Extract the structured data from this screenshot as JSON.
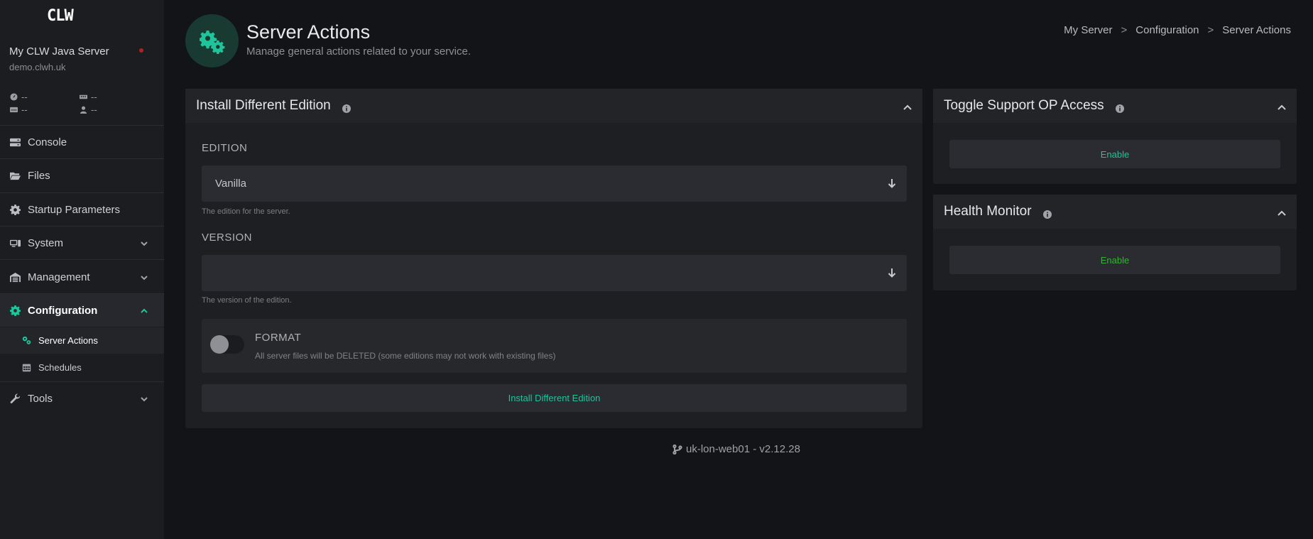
{
  "sidebar": {
    "logo": "CLW",
    "server_name": "My CLW Java Server",
    "server_host": "demo.clwh.uk",
    "stats": {
      "cpu": "--",
      "memory": "--",
      "disk": "--",
      "players": "--"
    },
    "nav": {
      "console": "Console",
      "files": "Files",
      "startup": "Startup Parameters",
      "system": "System",
      "management": "Management",
      "configuration": "Configuration",
      "server_actions": "Server Actions",
      "schedules": "Schedules",
      "tools": "Tools"
    }
  },
  "header": {
    "title": "Server Actions",
    "subtitle": "Manage general actions related to your service.",
    "breadcrumb": [
      "My Server",
      ">",
      "Configuration",
      ">",
      "Server Actions"
    ]
  },
  "install_card": {
    "title": "Install Different Edition",
    "edition_label": "EDITION",
    "edition_value": "Vanilla",
    "edition_help": "The edition for the server.",
    "version_label": "VERSION",
    "version_value": "",
    "version_help": "The version of the edition.",
    "format_title": "FORMAT",
    "format_desc": "All server files will be DELETED (some editions may not work with existing files)",
    "format_enabled": false,
    "button": "Install Different Edition"
  },
  "support_card": {
    "title": "Toggle Support OP Access",
    "button": "Enable"
  },
  "health_card": {
    "title": "Health Monitor",
    "button": "Enable"
  },
  "footer": {
    "version": "uk-lon-web01 - v2.12.28"
  },
  "colors": {
    "accent": "#1fc49a",
    "health_enable": "#2fb52f",
    "status_offline": "#b42020"
  }
}
